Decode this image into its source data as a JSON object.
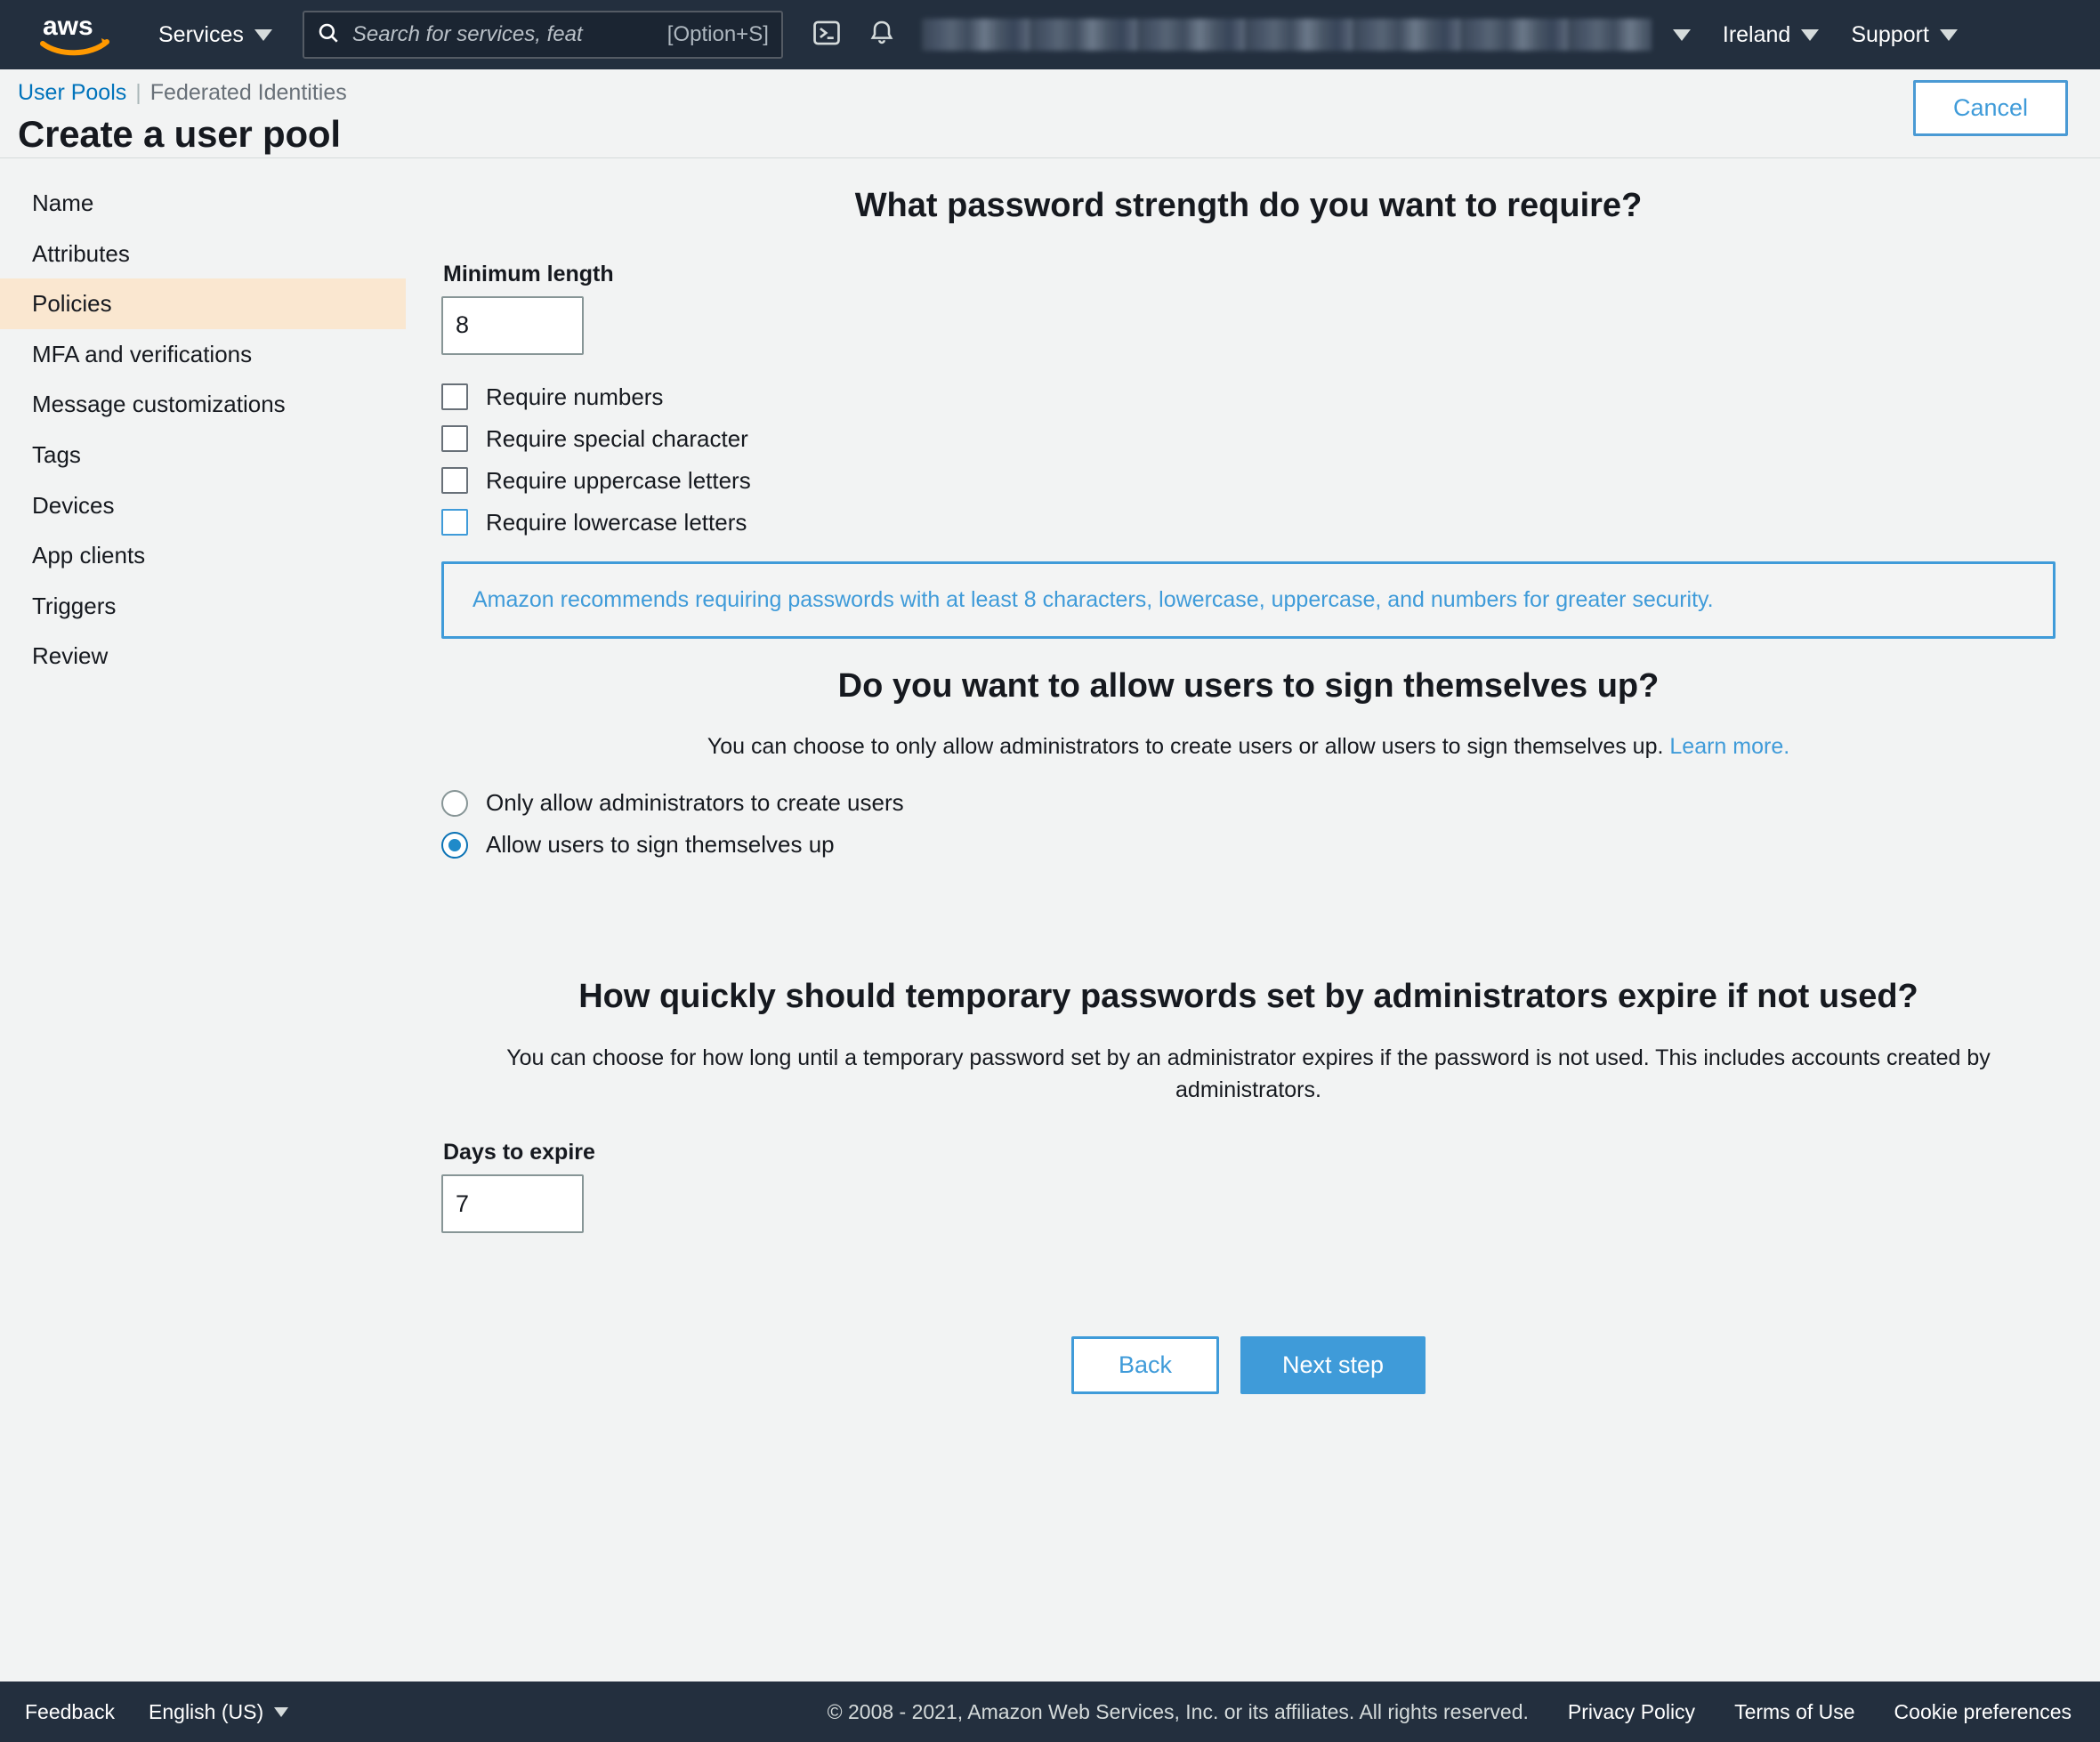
{
  "topnav": {
    "logo_alt": "aws",
    "services_label": "Services",
    "search": {
      "placeholder": "Search for services, feat",
      "shortcut": "[Option+S]",
      "value": ""
    },
    "cloudshell_icon": "cloudshell-terminal-icon",
    "bell_icon": "notifications-bell-icon",
    "account_label": "",
    "region_label": "Ireland",
    "support_label": "Support"
  },
  "header": {
    "breadcrumb": {
      "link_label": "User Pools",
      "separator": "|",
      "current_label": "Federated Identities"
    },
    "title": "Create a user pool",
    "cancel_label": "Cancel"
  },
  "sidebar": {
    "items": [
      {
        "label": "Name",
        "active": false
      },
      {
        "label": "Attributes",
        "active": false
      },
      {
        "label": "Policies",
        "active": true
      },
      {
        "label": "MFA and verifications",
        "active": false
      },
      {
        "label": "Message customizations",
        "active": false
      },
      {
        "label": "Tags",
        "active": false
      },
      {
        "label": "Devices",
        "active": false
      },
      {
        "label": "App clients",
        "active": false
      },
      {
        "label": "Triggers",
        "active": false
      },
      {
        "label": "Review",
        "active": false
      }
    ]
  },
  "main": {
    "password_strength": {
      "heading": "What password strength do you want to require?",
      "min_length_label": "Minimum length",
      "min_length_value": "8",
      "checkboxes": [
        {
          "label": "Require numbers",
          "checked": false,
          "focused": false
        },
        {
          "label": "Require special character",
          "checked": false,
          "focused": false
        },
        {
          "label": "Require uppercase letters",
          "checked": false,
          "focused": false
        },
        {
          "label": "Require lowercase letters",
          "checked": false,
          "focused": true
        }
      ],
      "recommendation": "Amazon recommends requiring passwords with at least 8 characters, lowercase, uppercase, and numbers for greater security."
    },
    "signup": {
      "heading": "Do you want to allow users to sign themselves up?",
      "description": "You can choose to only allow administrators to create users or allow users to sign themselves up.",
      "learn_more_label": "Learn more.",
      "options": [
        {
          "label": "Only allow administrators to create users",
          "selected": false
        },
        {
          "label": "Allow users to sign themselves up",
          "selected": true
        }
      ]
    },
    "temp_password": {
      "heading": "How quickly should temporary passwords set by administrators expire if not used?",
      "description": "You can choose for how long until a temporary password set by an administrator expires if the password is not used. This includes accounts created by administrators.",
      "days_label": "Days to expire",
      "days_value": "7"
    },
    "actions": {
      "back_label": "Back",
      "next_label": "Next step"
    }
  },
  "footer": {
    "feedback_label": "Feedback",
    "language_label": "English (US)",
    "copyright": "© 2008 - 2021, Amazon Web Services, Inc. or its affiliates. All rights reserved.",
    "privacy_label": "Privacy Policy",
    "terms_label": "Terms of Use",
    "cookie_label": "Cookie preferences"
  },
  "colors": {
    "nav_bg": "#232f3e",
    "page_bg": "#f2f3f3",
    "accent_blue": "#3f9bd9",
    "link_blue": "#0073bb",
    "active_nav_bg": "#fae7d0",
    "aws_orange": "#ff9900"
  }
}
